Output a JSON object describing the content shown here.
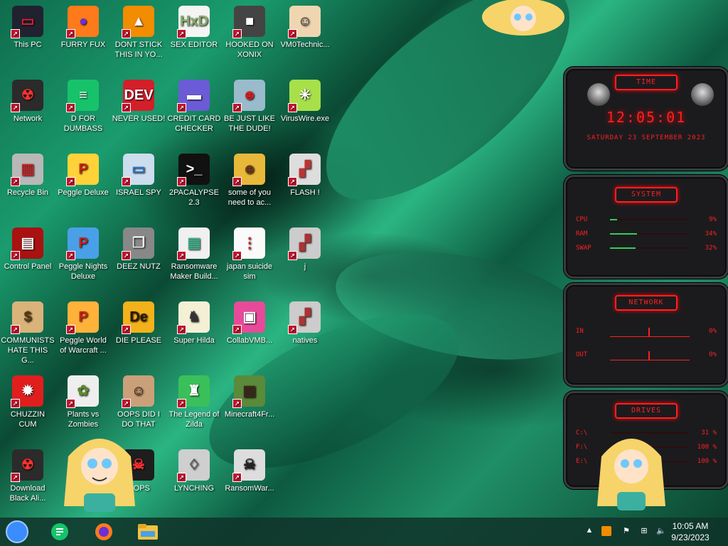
{
  "desktop": {
    "icons": [
      {
        "label": "This PC",
        "glyph": "▭",
        "bg": "#202230",
        "fg": "#d23"
      },
      {
        "label": "FURRY FUX",
        "glyph": "●",
        "bg": "#ff7a1a",
        "fg": "#6a2fd6"
      },
      {
        "label": "DONT STICK THIS IN YO...",
        "glyph": "▲",
        "bg": "#f28c00",
        "fg": "#fff"
      },
      {
        "label": "SEX EDITOR",
        "glyph": "HxD",
        "bg": "#f4f4f4",
        "fg": "#8a6"
      },
      {
        "label": "HOOKED ON XONIX",
        "glyph": "■",
        "bg": "#444",
        "fg": "#fff"
      },
      {
        "label": "VM0Technic...",
        "glyph": "☺",
        "bg": "#f0d6b0",
        "fg": "#333"
      },
      {
        "label": "Network",
        "glyph": "☢",
        "bg": "#2b2b2b",
        "fg": "#ff3030"
      },
      {
        "label": "D FOR DUMBASS",
        "glyph": "≡",
        "bg": "#17c36a",
        "fg": "#fff"
      },
      {
        "label": "NEVER USED!",
        "glyph": "DEV",
        "bg": "#d21f2a",
        "fg": "#fff"
      },
      {
        "label": "CREDIT CARD CHECKER",
        "glyph": "▬",
        "bg": "#6b5bd6",
        "fg": "#fff"
      },
      {
        "label": "BE JUST LIKE THE DUDE!",
        "glyph": "☻",
        "bg": "#9bc",
        "fg": "#c22"
      },
      {
        "label": "VirusWire.exe",
        "glyph": "✳",
        "bg": "#a8e04a",
        "fg": "#fff"
      },
      {
        "label": "Recycle Bin",
        "glyph": "▥",
        "bg": "#b8b8b8",
        "fg": "#c22"
      },
      {
        "label": "Peggle Deluxe",
        "glyph": "P",
        "bg": "#ffd23a",
        "fg": "#c21"
      },
      {
        "label": "ISRAEL SPY",
        "glyph": "▭",
        "bg": "#cde",
        "fg": "#27c"
      },
      {
        "label": "2PACALYPSE 2.3",
        "glyph": ">_",
        "bg": "#111",
        "fg": "#fff"
      },
      {
        "label": "some of you need to ac...",
        "glyph": "☻",
        "bg": "#e8b83a",
        "fg": "#6a3a1a"
      },
      {
        "label": "FLASH !",
        "glyph": "▞",
        "bg": "#ddd",
        "fg": "#b33"
      },
      {
        "label": "Control Panel",
        "glyph": "▤",
        "bg": "#a11",
        "fg": "#fff"
      },
      {
        "label": "Peggle Nights Deluxe",
        "glyph": "P",
        "bg": "#4aa0e8",
        "fg": "#c21"
      },
      {
        "label": "DEEZ NUTZ",
        "glyph": "❐",
        "bg": "#888",
        "fg": "#eee"
      },
      {
        "label": "Ransomware Maker Build...",
        "glyph": "▦",
        "bg": "#f0f0f0",
        "fg": "#4a8"
      },
      {
        "label": "japan suicide sim",
        "glyph": "⋮",
        "bg": "#fafafa",
        "fg": "#c22"
      },
      {
        "label": "j",
        "glyph": "▞",
        "bg": "#ccc",
        "fg": "#a33"
      },
      {
        "label": "COMMUNISTS HATE THIS G...",
        "glyph": "$",
        "bg": "#d9b37a",
        "fg": "#5a3a10"
      },
      {
        "label": "Peggle World of Warcraft ...",
        "glyph": "P",
        "bg": "#ffb23a",
        "fg": "#c21"
      },
      {
        "label": "DIE PLEASE",
        "glyph": "De",
        "bg": "#f3b21b",
        "fg": "#2a1a00"
      },
      {
        "label": "Super Hilda",
        "glyph": "♞",
        "bg": "#f4f0d6",
        "fg": "#333"
      },
      {
        "label": "CollabVMB...",
        "glyph": "▣",
        "bg": "#e84a9a",
        "fg": "#fff"
      },
      {
        "label": "natives",
        "glyph": "▞",
        "bg": "#ccc",
        "fg": "#a33"
      },
      {
        "label": "CHUZZIN CUM",
        "glyph": "✹",
        "bg": "#e01e1e",
        "fg": "#fff"
      },
      {
        "label": "Plants vs Zombies",
        "glyph": "✿",
        "bg": "#eee",
        "fg": "#5a8a2a"
      },
      {
        "label": "OOPS DID I DO THAT",
        "glyph": "☺",
        "bg": "#caa07a",
        "fg": "#3a2010"
      },
      {
        "label": "The Legend of Zilda",
        "glyph": "♜",
        "bg": "#3ac05a",
        "fg": "#fff"
      },
      {
        "label": "Minecraft4Fr...",
        "glyph": "▩",
        "bg": "#5a8a3a",
        "fg": "#3a2a1a"
      },
      {
        "label": "Download Black Ali...",
        "glyph": "☢",
        "bg": "#2b2b2b",
        "fg": "#ff3030"
      },
      {
        "label": "OOPS",
        "glyph": "☠",
        "bg": "#1e1e1e",
        "fg": "#ff3030"
      },
      {
        "label": "LYNCHING",
        "glyph": "♢",
        "bg": "#cfcfcf",
        "fg": "#555"
      },
      {
        "label": "RansomWar...",
        "glyph": "☠",
        "bg": "#ddd",
        "fg": "#222"
      }
    ]
  },
  "widgets": {
    "time": {
      "title": "TIME",
      "clock": "12:05:01",
      "date": "SATURDAY 23 SEPTEMBER 2023"
    },
    "system": {
      "title": "SYSTEM",
      "rows": [
        {
          "key": "CPU",
          "value": "9%",
          "level": 9
        },
        {
          "key": "RAM",
          "value": "34%",
          "level": 34
        },
        {
          "key": "SWAP",
          "value": "32%",
          "level": 32
        }
      ]
    },
    "network": {
      "title": "NETWORK",
      "rows": [
        {
          "key": "IN",
          "value": "0%"
        },
        {
          "key": "OUT",
          "value": "0%"
        }
      ]
    },
    "drives": {
      "title": "DRIVES",
      "rows": [
        {
          "key": "C:\\",
          "value": "31 %"
        },
        {
          "key": "F:\\",
          "value": "100 %"
        },
        {
          "key": "E:\\",
          "value": "100 %"
        }
      ]
    }
  },
  "taskbar": {
    "time": "10:05 AM",
    "date": "9/23/2023"
  },
  "colors": {
    "widget_red": "#ff2020",
    "widget_bg": "#1b1b1e",
    "taskbar": "#10342a"
  }
}
